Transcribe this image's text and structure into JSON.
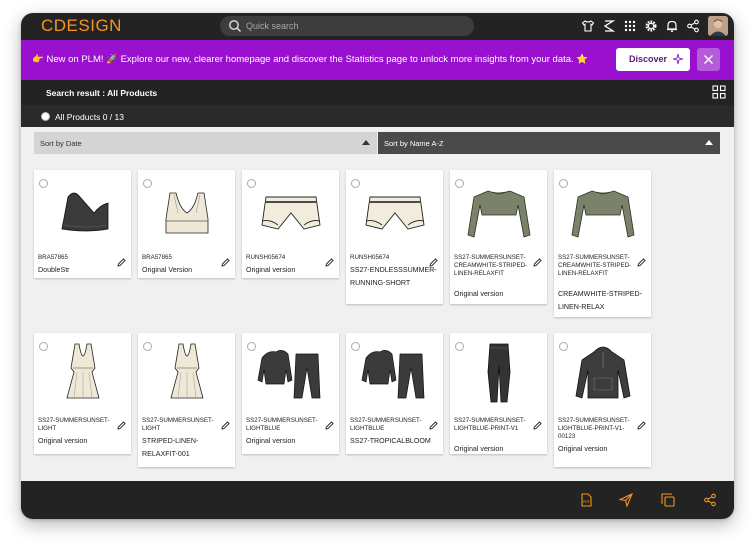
{
  "header": {
    "logo": "CDESIGN",
    "search_placeholder": "Quick search",
    "icons": [
      "tshirt-icon",
      "flow-icon",
      "apps-grid-icon",
      "settings-gear-icon",
      "notification-bell-icon",
      "share-icon"
    ]
  },
  "banner": {
    "text": "👉 New on PLM! 🚀 Explore our new, clearer homepage and discover the Statistics page to unlock more insights from your data. ⭐",
    "discover_label": "Discover",
    "accent": "#9a10cf"
  },
  "results": {
    "title": "Search result : All Products",
    "select_all_label": "All Products 0 / 13"
  },
  "sort": {
    "left_label": "Sort by Date",
    "right_label": "Sort by Name A-Z"
  },
  "products": [
    {
      "code": "BRA57865",
      "name": "DoubleStr",
      "image": "one-shoulder-bra"
    },
    {
      "code": "BRA57865",
      "name": "Original Version",
      "image": "sports-bra"
    },
    {
      "code": "RUNSH05674",
      "name": "Original version",
      "image": "running-shorts"
    },
    {
      "code": "RUNSH05674",
      "name": "SS27-ENDLESSSUMMER-RUNNING-SHORT",
      "image": "running-shorts"
    },
    {
      "code": "SS27-SUMMERSUNSET-CREAMWHITE-STRIPED-LINEN-RELAXFIT",
      "name": "Original version",
      "image": "crop-long-sleeve"
    },
    {
      "code": "SS27-SUMMERSUNSET-CREAMWHITE-STRIPED-LINEN-RELAXFIT",
      "name": "CREAMWHITE-STRIPED-LINEN-RELAX",
      "image": "crop-long-sleeve"
    },
    {
      "code": "SS27-SUMMERSUNSET-LIGHT",
      "name": "Original version",
      "image": "tennis-dress"
    },
    {
      "code": "SS27-SUMMERSUNSET-LIGHT",
      "name": "STRIPED-LINEN-RELAXFIT-001",
      "image": "tennis-dress"
    },
    {
      "code": "SS27-SUMMERSUNSET-LIGHTBLUE",
      "name": "Original version",
      "image": "hoodie-set"
    },
    {
      "code": "SS27-SUMMERSUNSET-LIGHTBLUE",
      "name": "SS27-TROPICALBLOOM",
      "image": "hoodie-set"
    },
    {
      "code": "SS27-SUMMERSUNSET-LIGHTBLUE-PRINT-V1",
      "name": "Original version",
      "image": "leggings"
    },
    {
      "code": "SS27-SUMMERSUNSET-LIGHTBLUE-PRINT-V1-00123",
      "name": "Original version",
      "image": "anorak-jacket"
    }
  ],
  "footer": {
    "icons": [
      "export-file-icon",
      "send-icon",
      "duplicate-icon",
      "share-icon"
    ],
    "accent": "#f5951f"
  }
}
